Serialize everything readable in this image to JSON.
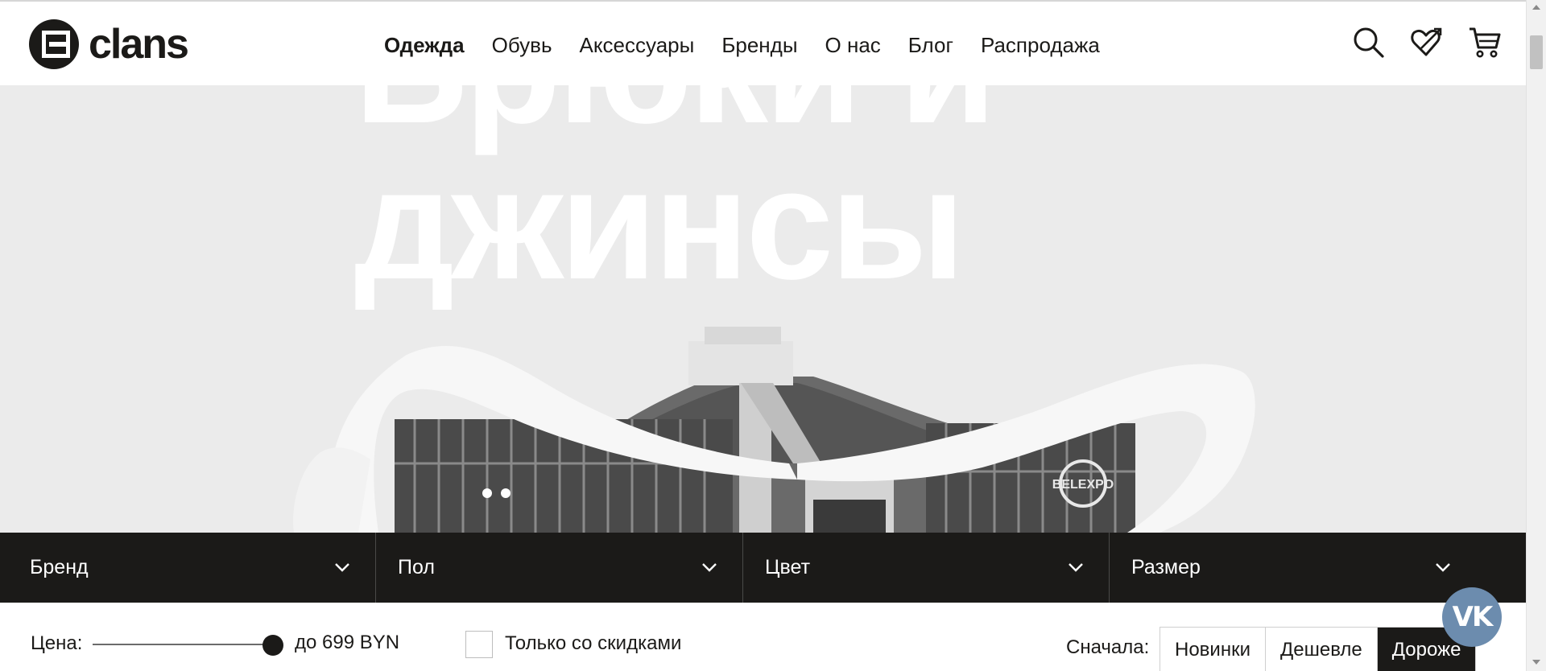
{
  "brand": {
    "name": "clans",
    "mark_icon": "clans-logo-icon"
  },
  "nav": {
    "items": [
      {
        "label": "Одежда",
        "active": true
      },
      {
        "label": "Обувь",
        "active": false
      },
      {
        "label": "Аксессуары",
        "active": false
      },
      {
        "label": "Бренды",
        "active": false
      },
      {
        "label": "О нас",
        "active": false
      },
      {
        "label": "Блог",
        "active": false
      },
      {
        "label": "Распродажа",
        "active": false
      }
    ]
  },
  "header_icons": [
    "search-icon",
    "wishlist-heart-icon",
    "cart-icon"
  ],
  "hero": {
    "title_line1": "Брюки и",
    "title_line2": "джинсы",
    "sign_text": "BELEXPO"
  },
  "filters": [
    {
      "label": "Бренд"
    },
    {
      "label": "Пол"
    },
    {
      "label": "Цвет"
    },
    {
      "label": "Размер"
    }
  ],
  "price": {
    "label": "Цена:",
    "value_text": "до 699 BYN",
    "slider_fraction": 1.0
  },
  "discount_filter": {
    "label": "Только со скидками",
    "checked": false
  },
  "sort": {
    "label": "Сначала:",
    "options": [
      {
        "label": "Новинки",
        "active": false
      },
      {
        "label": "Дешевле",
        "active": false
      },
      {
        "label": "Дороже",
        "active": true
      }
    ]
  },
  "social": {
    "vk_label": "vk"
  },
  "colors": {
    "dark": "#1b1a18",
    "hero_bg": "#ebebeb",
    "vk": "#6c8cae"
  }
}
